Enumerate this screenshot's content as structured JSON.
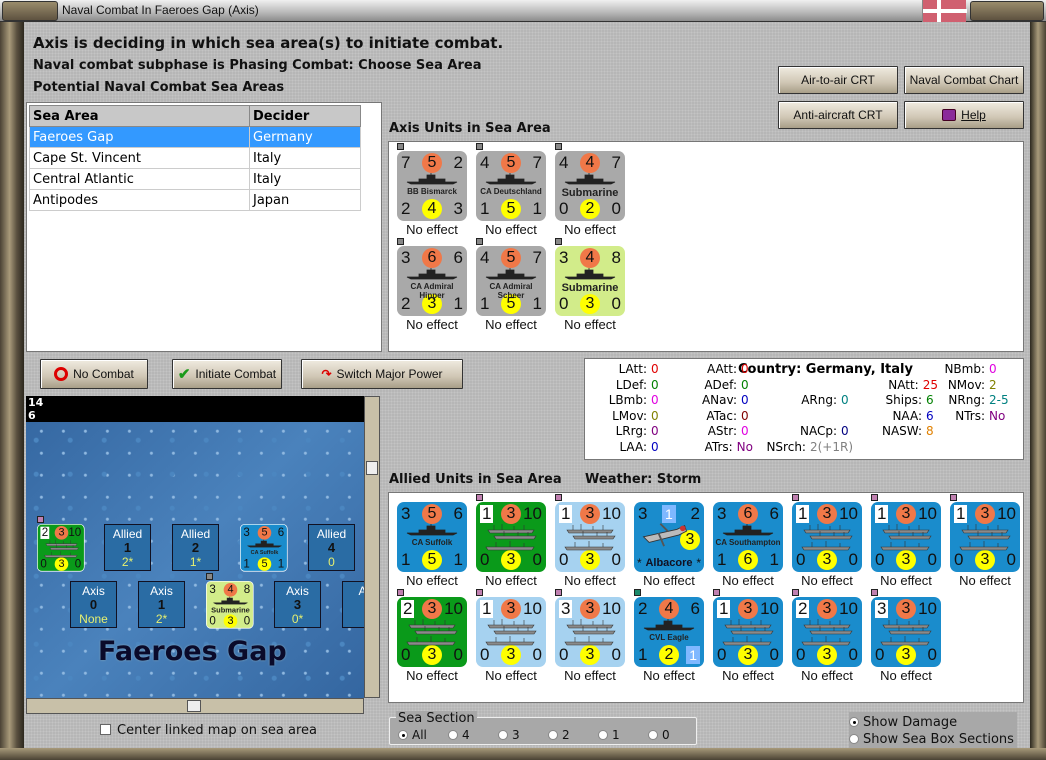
{
  "window": {
    "title": "Naval Combat In Faeroes Gap (Axis)"
  },
  "header": {
    "line1": "Axis is deciding in which sea area(s) to initiate combat.",
    "line2": "Naval combat subphase is Phasing Combat: Choose Sea Area",
    "line3": "Potential Naval Combat Sea Areas"
  },
  "buttons": {
    "air_to_air": "Air-to-air CRT",
    "naval_chart": "Naval Combat Chart",
    "anti_aircraft": "Anti-aircraft CRT",
    "help": "Help",
    "no_combat": "No Combat",
    "initiate": "Initiate Combat",
    "switch": "Switch Major Power"
  },
  "sea_table": {
    "headers": [
      "Sea Area",
      "Decider"
    ],
    "rows": [
      [
        "Faeroes Gap",
        "Germany"
      ],
      [
        "Cape St. Vincent",
        "Italy"
      ],
      [
        "Central Atlantic",
        "Italy"
      ],
      [
        "Antipodes",
        "Japan"
      ]
    ],
    "selected": 0
  },
  "axis_label": "Axis Units in Sea Area",
  "allied_label": "Allied Units in Sea Area",
  "weather": "Weather:  Storm",
  "colors": {
    "gray": "#a9a9a9",
    "sub": "#d2ec8a",
    "blue": "#1a8ccc",
    "green": "#0a9a1a",
    "light": "#a6d2f0",
    "attack": "#f07848",
    "defense": "#ffff00"
  },
  "axis_units": [
    {
      "tl": "7",
      "atk": "5",
      "tr": "2",
      "name": "BB Bismarck",
      "bl": "2",
      "def": "4",
      "br": "3",
      "color": "gray",
      "result": "No effect"
    },
    {
      "tl": "4",
      "atk": "5",
      "tr": "7",
      "name": "CA Deutschland",
      "bl": "1",
      "def": "5",
      "br": "1",
      "color": "gray",
      "result": "No effect"
    },
    {
      "tl": "4",
      "atk": "4",
      "tr": "7",
      "name": "Submarine",
      "bl": "0",
      "def": "2",
      "br": "0",
      "color": "gray",
      "result": "No effect"
    },
    {
      "tl": "3",
      "atk": "6",
      "tr": "6",
      "name": "CA Admiral Hipper",
      "bl": "2",
      "def": "3",
      "br": "1",
      "color": "gray",
      "result": "No effect"
    },
    {
      "tl": "4",
      "atk": "5",
      "tr": "7",
      "name": "CA Admiral Scheer",
      "bl": "1",
      "def": "5",
      "br": "1",
      "color": "gray",
      "result": "No effect"
    },
    {
      "tl": "3",
      "atk": "4",
      "tr": "8",
      "name": "Submarine",
      "bl": "0",
      "def": "3",
      "br": "0",
      "color": "sub",
      "result": "No effect"
    }
  ],
  "allied_units": [
    {
      "tl": "3",
      "atk": "5",
      "tr": "6",
      "name": "CA Suffolk",
      "bl": "1",
      "def": "5",
      "br": "1",
      "color": "blue",
      "result": "No effect"
    },
    {
      "tl": "1",
      "atk": "3",
      "tr": "10",
      "name": "",
      "bl": "0",
      "def": "3",
      "br": "0",
      "color": "green",
      "convoy": true,
      "result": "No effect"
    },
    {
      "tl": "1",
      "atk": "3",
      "tr": "10",
      "name": "",
      "bl": "0",
      "def": "3",
      "br": "0",
      "color": "light",
      "convoy": true,
      "result": "No effect"
    },
    {
      "tl": "3",
      "atk": "1",
      "tr": "2",
      "name": "Albacore",
      "def": "3",
      "color": "blue",
      "plane": true,
      "result": "No effect"
    },
    {
      "tl": "3",
      "atk": "6",
      "tr": "6",
      "name": "CA Southampton",
      "bl": "1",
      "def": "6",
      "br": "1",
      "color": "blue",
      "result": "No effect"
    },
    {
      "tl": "1",
      "atk": "3",
      "tr": "10",
      "name": "",
      "bl": "0",
      "def": "3",
      "br": "0",
      "color": "blue",
      "convoy": true,
      "result": "No effect"
    },
    {
      "tl": "1",
      "atk": "3",
      "tr": "10",
      "name": "",
      "bl": "0",
      "def": "3",
      "br": "0",
      "color": "blue",
      "convoy": true,
      "result": "No effect"
    },
    {
      "tl": "1",
      "atk": "3",
      "tr": "10",
      "name": "",
      "bl": "0",
      "def": "3",
      "br": "0",
      "color": "blue",
      "convoy": true,
      "result": "No effect"
    },
    {
      "tl": "2",
      "atk": "3",
      "tr": "10",
      "name": "",
      "bl": "0",
      "def": "3",
      "br": "0",
      "color": "green",
      "convoy": true,
      "result": "No effect"
    },
    {
      "tl": "1",
      "atk": "3",
      "tr": "10",
      "name": "",
      "bl": "0",
      "def": "3",
      "br": "0",
      "color": "light",
      "convoy": true,
      "result": "No effect"
    },
    {
      "tl": "3",
      "atk": "3",
      "tr": "10",
      "name": "",
      "bl": "0",
      "def": "3",
      "br": "0",
      "color": "light",
      "convoy": true,
      "result": "No effect"
    },
    {
      "tl": "2",
      "atk": "4",
      "tr": "6",
      "name": "CVL Eagle",
      "bl": "1",
      "def": "2",
      "br": "1",
      "color": "blue",
      "carrier": true,
      "result": "No effect"
    },
    {
      "tl": "1",
      "atk": "3",
      "tr": "10",
      "name": "",
      "bl": "0",
      "def": "3",
      "br": "0",
      "color": "blue",
      "convoy": true,
      "result": "No effect"
    },
    {
      "tl": "2",
      "atk": "3",
      "tr": "10",
      "name": "",
      "bl": "0",
      "def": "3",
      "br": "0",
      "color": "blue",
      "convoy": true,
      "result": "No effect"
    },
    {
      "tl": "3",
      "atk": "3",
      "tr": "10",
      "name": "",
      "bl": "0",
      "def": "3",
      "br": "0",
      "color": "blue",
      "convoy": true,
      "result": "No effect"
    }
  ],
  "stats": {
    "country": "Country: Germany, Italy",
    "items": [
      {
        "k": "LAtt:",
        "v": "0",
        "c": "#e00000"
      },
      {
        "k": "LDef:",
        "v": "0",
        "c": "#008000"
      },
      {
        "k": "LBmb:",
        "v": "0",
        "c": "#e000e0"
      },
      {
        "k": "LMov:",
        "v": "0",
        "c": "#808000"
      },
      {
        "k": "LRrg:",
        "v": "0",
        "c": "#800080"
      },
      {
        "k": "LAA:",
        "v": "0",
        "c": "#0000c0"
      },
      {
        "k": "AAtt:",
        "v": "0",
        "c": "#e00000"
      },
      {
        "k": "ADef:",
        "v": "0",
        "c": "#008000"
      },
      {
        "k": "ANav:",
        "v": "0",
        "c": "#0000c0"
      },
      {
        "k": "ATac:",
        "v": "0",
        "c": "#800000"
      },
      {
        "k": "AStr:",
        "v": "0",
        "c": "#e000e0"
      },
      {
        "k": "ATrs:",
        "v": "No",
        "c": "#800080"
      },
      {
        "k": "ARng:",
        "v": "0",
        "c": "#008080"
      },
      {
        "k": "NACp:",
        "v": "0",
        "c": "#000080"
      },
      {
        "k": "NSrch:",
        "v": "2(+1R)",
        "c": "#808080"
      },
      {
        "k": "NAtt:",
        "v": "25",
        "c": "#e00000"
      },
      {
        "k": "Ships:",
        "v": "6",
        "c": "#008000"
      },
      {
        "k": "NAA:",
        "v": "6",
        "c": "#0000c0"
      },
      {
        "k": "NASW:",
        "v": "8",
        "c": "#e08000"
      },
      {
        "k": "NBmb:",
        "v": "0",
        "c": "#e000e0"
      },
      {
        "k": "NMov:",
        "v": "2",
        "c": "#808000"
      },
      {
        "k": "NRng:",
        "v": "2-5",
        "c": "#008080"
      },
      {
        "k": "NTrs:",
        "v": "No",
        "c": "#800080"
      }
    ]
  },
  "map": {
    "sea_name": "Faeroes Gap",
    "allied_boxes": [
      {
        "side": "Allied",
        "num": "1",
        "val": "2*"
      },
      {
        "side": "Allied",
        "num": "2",
        "val": "1*"
      },
      {
        "side": "Allied",
        "num": "4",
        "val": "0"
      }
    ],
    "axis_boxes": [
      {
        "side": "Axis",
        "num": "0",
        "val": "None"
      },
      {
        "side": "Axis",
        "num": "1",
        "val": "2*"
      },
      {
        "side": "Axis",
        "num": "3",
        "val": "0*"
      },
      {
        "side": "Ax",
        "num": "",
        "val": ""
      }
    ],
    "stack_counts": [
      "14",
      "6"
    ]
  },
  "center_map": "Center linked map on sea area",
  "sea_section": {
    "label": "Sea Section",
    "options": [
      "All",
      "4",
      "3",
      "2",
      "1",
      "0"
    ],
    "selected": "All"
  },
  "view": {
    "options": [
      "Show Damage",
      "Show Sea Box Sections"
    ],
    "selected": "Show Damage"
  }
}
